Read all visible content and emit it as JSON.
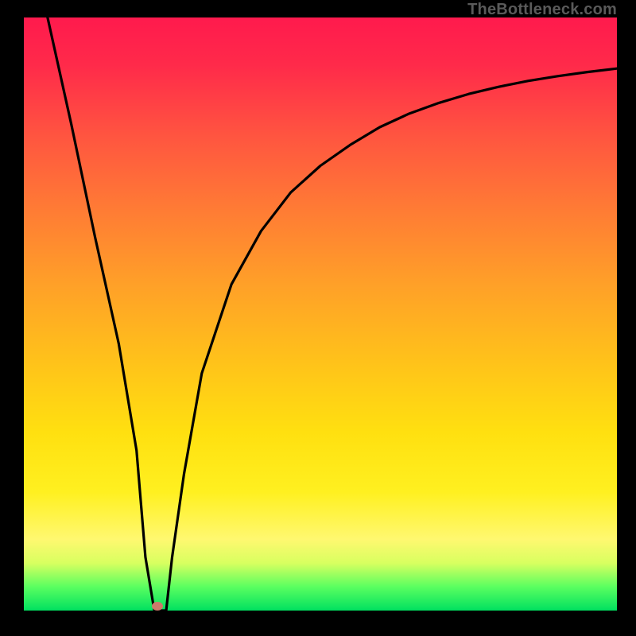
{
  "watermark": "TheBottleneck.com",
  "marker": {
    "x_pct": 22.5,
    "y_pct": 99.2
  },
  "chart_data": {
    "type": "line",
    "title": "",
    "xlabel": "",
    "ylabel": "",
    "xlim": [
      0,
      100
    ],
    "ylim": [
      0,
      100
    ],
    "series": [
      {
        "name": "curve",
        "x": [
          4,
          8,
          12,
          16,
          19,
          20.5,
          22,
          24,
          25,
          27,
          30,
          35,
          40,
          45,
          50,
          55,
          60,
          65,
          70,
          75,
          80,
          85,
          90,
          95,
          100
        ],
        "y": [
          100,
          82,
          63,
          45,
          27,
          9,
          0,
          0,
          9,
          23,
          40,
          55,
          64,
          70.5,
          75,
          78.5,
          81.5,
          83.8,
          85.6,
          87.1,
          88.3,
          89.3,
          90.1,
          90.8,
          91.4
        ]
      }
    ],
    "marker_point": {
      "x": 22.5,
      "y": 0.8
    },
    "background_gradient": {
      "top": "#ff1a4d",
      "mid": "#ffc21a",
      "bottom": "#00e060"
    }
  }
}
